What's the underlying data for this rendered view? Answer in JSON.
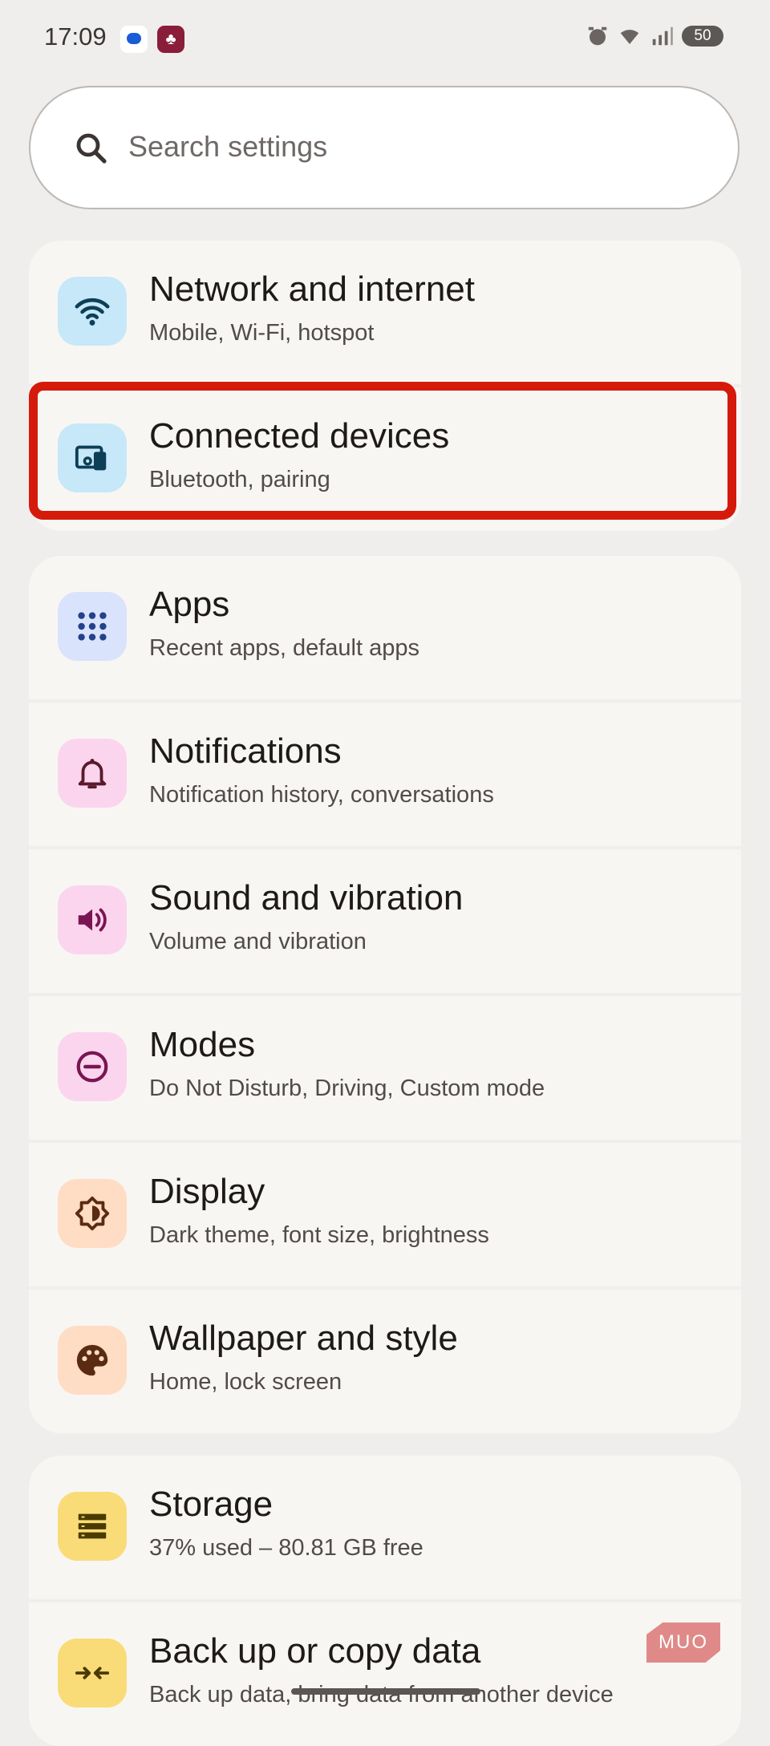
{
  "status_bar": {
    "time": "17:09",
    "battery": "50",
    "icons": [
      "messages-icon",
      "app-icon",
      "alarm-icon",
      "wifi-icon",
      "signal-icon",
      "battery-icon"
    ]
  },
  "search": {
    "placeholder": "Search settings"
  },
  "groups": [
    {
      "items": [
        {
          "title": "Network and internet",
          "subtitle": "Mobile, Wi-Fi, hotspot",
          "icon": "wifi-icon"
        },
        {
          "title": "Connected devices",
          "subtitle": "Bluetooth, pairing",
          "icon": "connected-devices-icon"
        }
      ]
    },
    {
      "items": [
        {
          "title": "Apps",
          "subtitle": "Recent apps, default apps",
          "icon": "apps-grid-icon"
        },
        {
          "title": "Notifications",
          "subtitle": "Notification history, conversations",
          "icon": "bell-icon"
        },
        {
          "title": "Sound and vibration",
          "subtitle": "Volume and vibration",
          "icon": "speaker-icon"
        },
        {
          "title": "Modes",
          "subtitle": "Do Not Disturb, Driving, Custom mode",
          "icon": "do-not-disturb-icon"
        },
        {
          "title": "Display",
          "subtitle": "Dark theme, font size, brightness",
          "icon": "brightness-icon"
        },
        {
          "title": "Wallpaper and style",
          "subtitle": "Home, lock screen",
          "icon": "palette-icon"
        }
      ]
    },
    {
      "items": [
        {
          "title": "Storage",
          "subtitle": "37% used – 80.81 GB free",
          "icon": "storage-icon"
        },
        {
          "title": "Back up or copy data",
          "subtitle": "Back up data, bring data from another device",
          "icon": "backup-icon"
        }
      ]
    }
  ],
  "watermark": "MUO",
  "colors": {
    "background": "#f0eeec",
    "card": "#f8f6f3",
    "highlight": "#d51a0b",
    "icon_blue_bg": "#c6e8f8",
    "icon_lavender_bg": "#d9e3fb",
    "icon_pink_bg": "#fbd5ee",
    "icon_peach_bg": "#ffdcc4",
    "icon_yellow_bg": "#f9dc78"
  }
}
